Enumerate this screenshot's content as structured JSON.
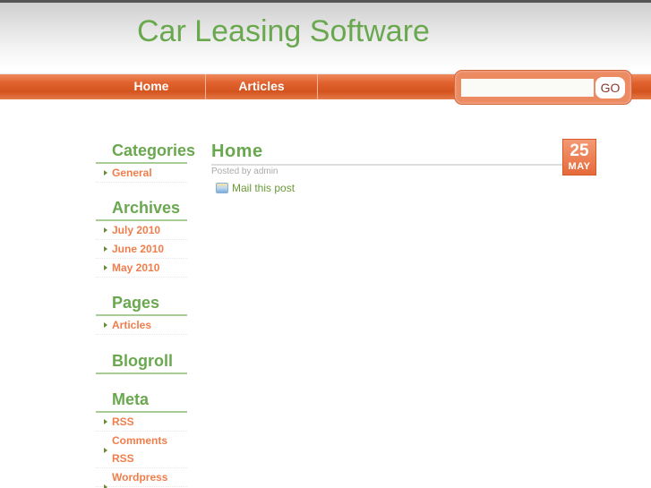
{
  "header": {
    "site_title": "Car Leasing Software"
  },
  "nav": {
    "items": [
      {
        "label": "Home"
      },
      {
        "label": "Articles"
      }
    ]
  },
  "search": {
    "value": "",
    "placeholder": "",
    "button_label": "GO"
  },
  "sidebar": {
    "categories": {
      "title": "Categories",
      "items": [
        {
          "label": "General"
        }
      ]
    },
    "archives": {
      "title": "Archives",
      "items": [
        {
          "label": "July 2010"
        },
        {
          "label": "June 2010"
        },
        {
          "label": "May 2010"
        }
      ]
    },
    "pages": {
      "title": "Pages",
      "items": [
        {
          "label": "Articles"
        }
      ]
    },
    "blogroll": {
      "title": "Blogroll"
    },
    "meta": {
      "title": "Meta",
      "items": [
        {
          "label": "RSS"
        },
        {
          "label": "Comments RSS"
        },
        {
          "label": "Wordpress"
        }
      ]
    }
  },
  "post": {
    "title": "Home",
    "meta": "Posted by admin",
    "mail_link": "Mail this post",
    "date": {
      "day": "25",
      "month": "MAY"
    }
  },
  "colors": {
    "brand_green": "#6aa84f",
    "nav_orange": "#e0612d",
    "link_orange": "#f07e4c"
  }
}
